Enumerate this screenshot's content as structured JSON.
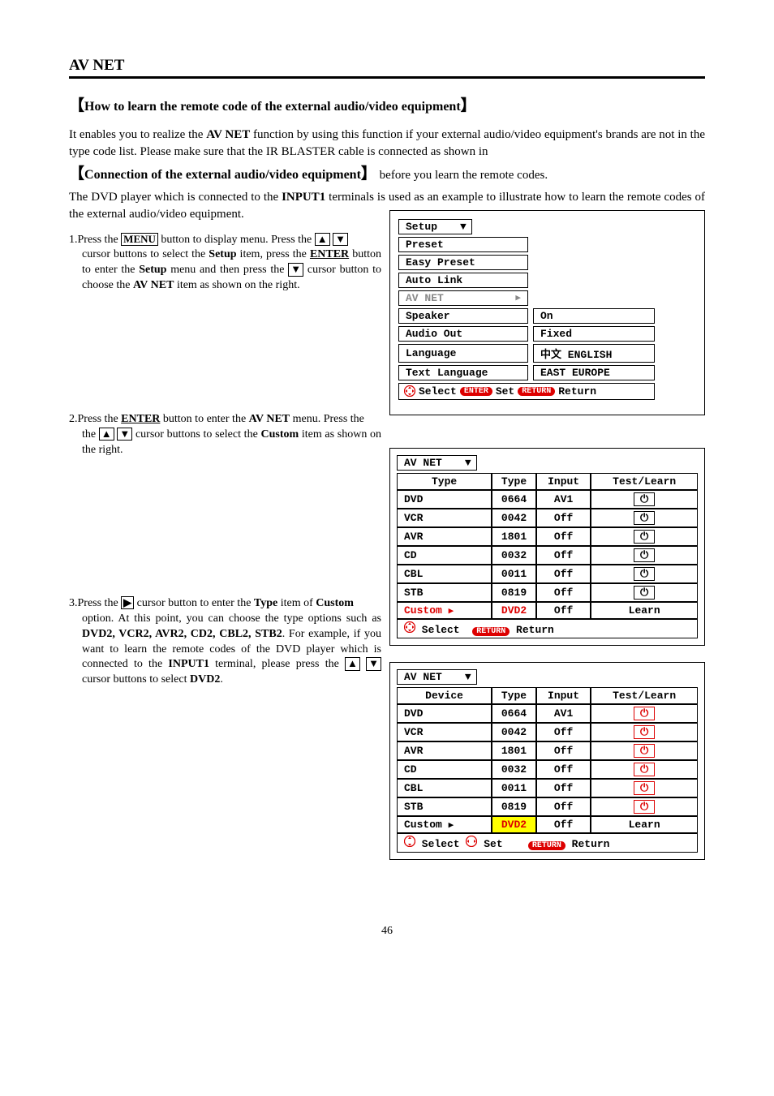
{
  "page": {
    "title": "AV NET",
    "heading": "How to learn the remote code of the external audio/video equipment",
    "number": "46"
  },
  "intro": {
    "p1a": "It enables you to realize the ",
    "p1bold": "AV NET",
    "p1b": " function by using this function if your external audio/video equipment's brands are not in the type code list. Please make sure that the IR BLASTER cable is connected as shown in",
    "inlineHeading": "Connection of the external audio/video equipment",
    "p1c": " before you learn the remote codes.",
    "p2a": "The DVD player which is connected to the ",
    "p2bold": "INPUT1",
    "p2b": " terminals is used as an example to illustrate how to learn the remote codes of the external audio/video equipment."
  },
  "steps": {
    "s1": {
      "a": "1.Press the ",
      "menu": "MENU",
      "b": " button to display menu. Press the ",
      "c": " cursor buttons to select the ",
      "setup": "Setup",
      "d": " item, press the ",
      "enter": "ENTER",
      "e": " button to enter the ",
      "setup2": "Setup",
      "f": " menu and then press the ",
      "g": " cursor button to choose the ",
      "avnet": "AV NET",
      "h": " item as shown on the right."
    },
    "s2": {
      "a": "2.Press the ",
      "enter": "ENTER",
      "b": " button to enter the ",
      "avnet": "AV NET",
      "c": " menu. Press the ",
      "d": " cursor buttons to select the ",
      "custom": "Custom",
      "e": " item as shown on the right."
    },
    "s3": {
      "a": "3.Press the ",
      "b": " cursor button to enter the ",
      "type": "Type",
      "c": " item of ",
      "custom": "Custom",
      "d": " option. At this point, you can choose the type options such as ",
      "opts": "DVD2, VCR2, AVR2, CD2, CBL2, STB2",
      "e": ". For example, if you want to learn the remote codes of the DVD player which is connected to the ",
      "input1": "INPUT1",
      "f": " terminal, please press the ",
      "g": " cursor buttons to select ",
      "dvd2": "DVD2",
      "h": "."
    }
  },
  "osdSetup": {
    "tab": "Setup",
    "items": [
      {
        "label": "Preset",
        "value": null
      },
      {
        "label": "Easy Preset",
        "value": null
      },
      {
        "label": "Auto Link",
        "value": null
      },
      {
        "label": "AV NET",
        "value": null,
        "muted": true,
        "arrow": true
      },
      {
        "label": "Speaker",
        "value": "On"
      },
      {
        "label": "Audio Out",
        "value": "Fixed"
      },
      {
        "label": "Language",
        "value": "中文  ENGLISH"
      },
      {
        "label": "Text Language",
        "value": "EAST EUROPE"
      }
    ],
    "help": {
      "select": "Select",
      "set": "Set",
      "ret": "Return",
      "enter": "ENTER",
      "return": "RETURN"
    }
  },
  "osdTable1": {
    "tab": "AV NET",
    "headers": [
      "Type",
      "Type",
      "Input",
      "Test/Learn"
    ],
    "rows": [
      {
        "c0": "DVD",
        "c1": "0664",
        "c2": "AV1",
        "btn": "pwr"
      },
      {
        "c0": "VCR",
        "c1": "0042",
        "c2": "Off",
        "btn": "pwr"
      },
      {
        "c0": "AVR",
        "c1": "1801",
        "c2": "Off",
        "btn": "pwr"
      },
      {
        "c0": "CD",
        "c1": "0032",
        "c2": "Off",
        "btn": "pwr"
      },
      {
        "c0": "CBL",
        "c1": "0011",
        "c2": "Off",
        "btn": "pwr"
      },
      {
        "c0": "STB",
        "c1": "0819",
        "c2": "Off",
        "btn": "pwr"
      },
      {
        "c0": "Custom",
        "c1": "DVD2",
        "c2": "Off",
        "btn": "Learn",
        "hl": "row-red"
      }
    ],
    "help": {
      "select": "Select",
      "return": "RETURN",
      "ret": "Return"
    }
  },
  "osdTable2": {
    "tab": "AV NET",
    "headers": [
      "Device",
      "Type",
      "Input",
      "Test/Learn"
    ],
    "rows": [
      {
        "c0": "DVD",
        "c1": "0664",
        "c2": "AV1",
        "btn": "pwr-red"
      },
      {
        "c0": "VCR",
        "c1": "0042",
        "c2": "Off",
        "btn": "pwr-red"
      },
      {
        "c0": "AVR",
        "c1": "1801",
        "c2": "Off",
        "btn": "pwr-red"
      },
      {
        "c0": "CD",
        "c1": "0032",
        "c2": "Off",
        "btn": "pwr-red"
      },
      {
        "c0": "CBL",
        "c1": "0011",
        "c2": "Off",
        "btn": "pwr-red"
      },
      {
        "c0": "STB",
        "c1": "0819",
        "c2": "Off",
        "btn": "pwr-red"
      },
      {
        "c0": "Custom",
        "c1": "DVD2",
        "c2": "Off",
        "btn": "Learn",
        "hl": "cell-yellow"
      }
    ],
    "help": {
      "select": "Select",
      "set": "Set",
      "return": "RETURN",
      "ret": "Return"
    }
  }
}
